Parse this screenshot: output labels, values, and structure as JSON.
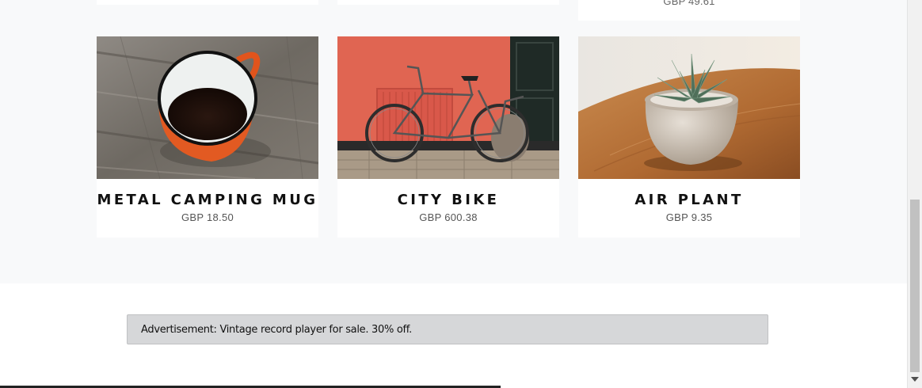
{
  "products_above": [
    {
      "price": ""
    },
    {
      "price": ""
    },
    {
      "price": "GBP 49.61"
    }
  ],
  "products": [
    {
      "name": "METAL CAMPING MUG",
      "price": "GBP 18.50",
      "image": "camping-mug-photo"
    },
    {
      "name": "CITY BIKE",
      "price": "GBP 600.38",
      "image": "city-bike-photo"
    },
    {
      "name": "AIR PLANT",
      "price": "GBP 9.35",
      "image": "air-plant-photo"
    }
  ],
  "advertisement": {
    "text": "Advertisement: Vintage record player for sale. 30% off."
  },
  "colors": {
    "section_bg": "#f8f9fa",
    "card_bg": "#ffffff",
    "ad_bg": "#d6d7d9"
  }
}
